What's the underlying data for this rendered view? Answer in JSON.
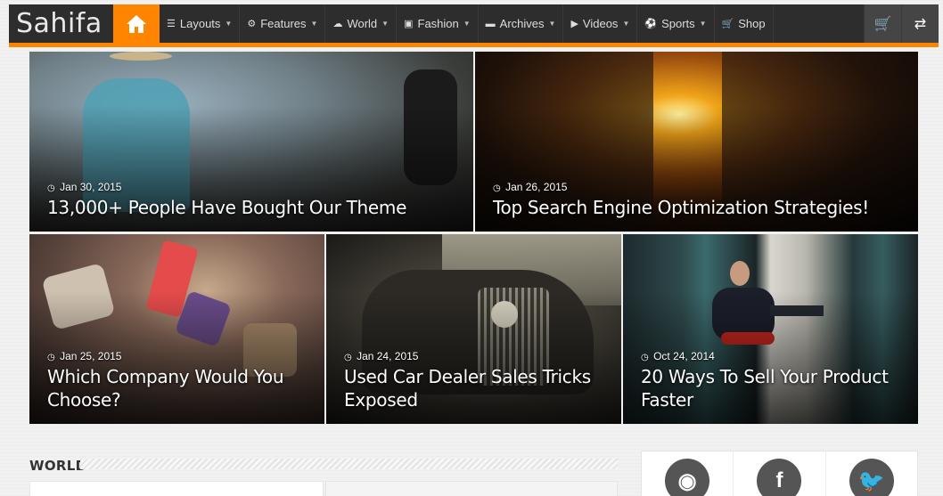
{
  "brand": {
    "logo_text": "Sahifa",
    "accent": "#ff8500"
  },
  "nav": {
    "items": [
      {
        "label": "Layouts",
        "icon": "bars-icon",
        "glyph": "☰"
      },
      {
        "label": "Features",
        "icon": "cogs-icon",
        "glyph": "⚙"
      },
      {
        "label": "World",
        "icon": "cloud-icon",
        "glyph": "☁"
      },
      {
        "label": "Fashion",
        "icon": "briefcase-icon",
        "glyph": "▣"
      },
      {
        "label": "Archives",
        "icon": "folder-icon",
        "glyph": "▬"
      },
      {
        "label": "Videos",
        "icon": "play-circle-icon",
        "glyph": "▶"
      },
      {
        "label": "Sports",
        "icon": "soccer-ball-icon",
        "glyph": "⚽"
      },
      {
        "label": "Shop",
        "icon": "cart-icon",
        "glyph": "🛒",
        "no_caret": true
      }
    ],
    "right_buttons": [
      {
        "icon": "cart-icon",
        "glyph": "🛒"
      },
      {
        "icon": "shuffle-icon",
        "glyph": "⇄"
      }
    ]
  },
  "featured": [
    {
      "date": "Jan 30, 2015",
      "title": "13,000+ People Have Bought Our Theme"
    },
    {
      "date": "Jan 26, 2015",
      "title": "Top Search Engine Optimization Strategies!"
    },
    {
      "date": "Jan 25, 2015",
      "title": "Which Company Would You Choose?"
    },
    {
      "date": "Jan 24, 2015",
      "title": "Used Car Dealer Sales Tricks Exposed"
    },
    {
      "date": "Oct 24, 2014",
      "title": "20 Ways To Sell Your Product Faster"
    }
  ],
  "world_section": {
    "title": "WORLD"
  },
  "social": [
    {
      "icon": "rss-icon",
      "glyph": "◉"
    },
    {
      "icon": "facebook-icon",
      "glyph": "f"
    },
    {
      "icon": "twitter-icon",
      "glyph": "🐦"
    }
  ]
}
